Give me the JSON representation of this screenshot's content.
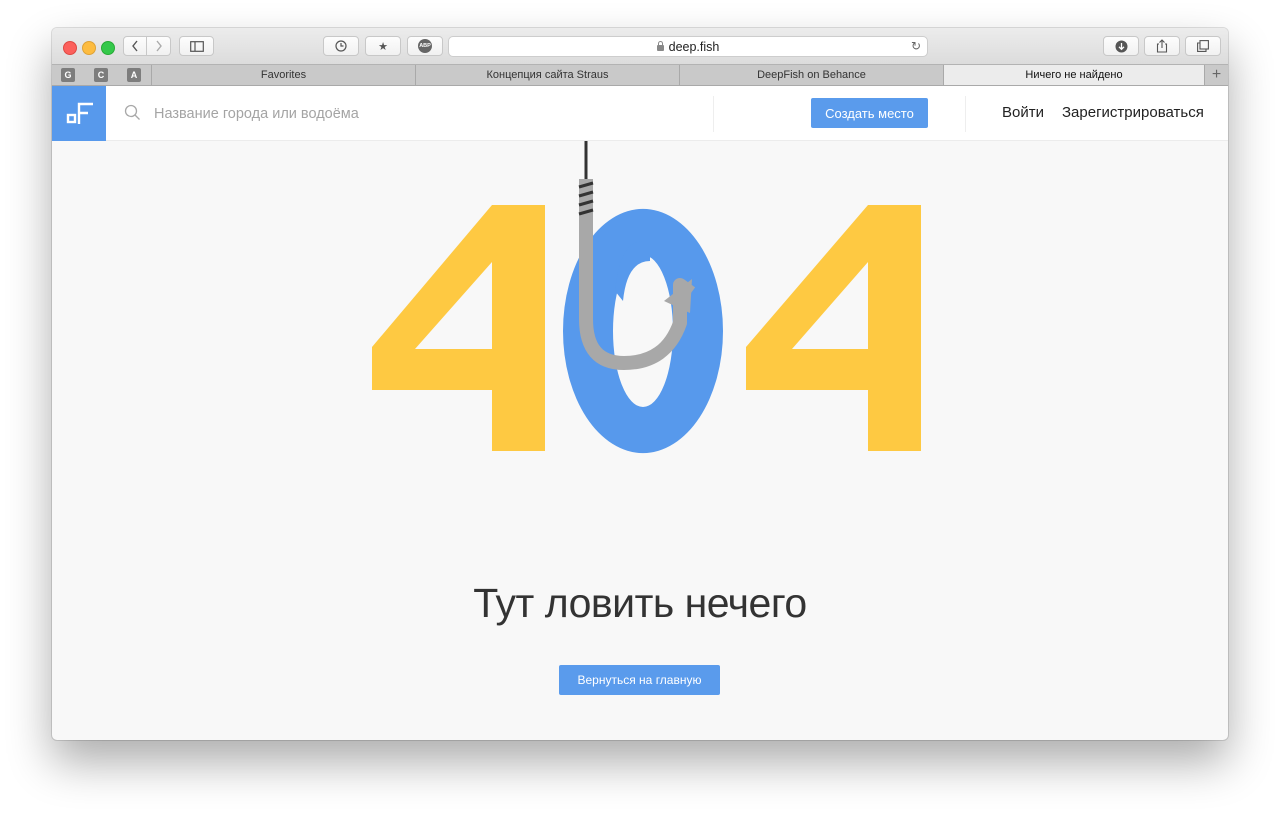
{
  "browser": {
    "address": "deep.fish",
    "pinned_tabs": [
      "G",
      "C",
      "A"
    ],
    "tabs": [
      {
        "label": "Favorites"
      },
      {
        "label": "Концепция сайта Straus"
      },
      {
        "label": "DeepFish on Behance"
      },
      {
        "label": "Ничего не найдено"
      }
    ],
    "toolbar_icons": [
      "back-icon",
      "forward-icon",
      "sidebar-icon",
      "history-icon",
      "bookmark-star-icon",
      "adblock-icon",
      "reload-icon",
      "download-icon",
      "share-icon",
      "tabs-overview-icon"
    ],
    "adblock_label": "ABP"
  },
  "header": {
    "search_placeholder": "Название города или водоёма",
    "create_label": "Создать место",
    "login_label": "Войти",
    "register_label": "Зарегистрироваться"
  },
  "main": {
    "error_code": "404",
    "tagline": "Тут ловить нечего",
    "home_button": "Вернуться на главную"
  },
  "colors": {
    "brand_blue": "#5799ec",
    "digit_yellow": "#fec942",
    "hook_gray": "#a8a8a8"
  }
}
